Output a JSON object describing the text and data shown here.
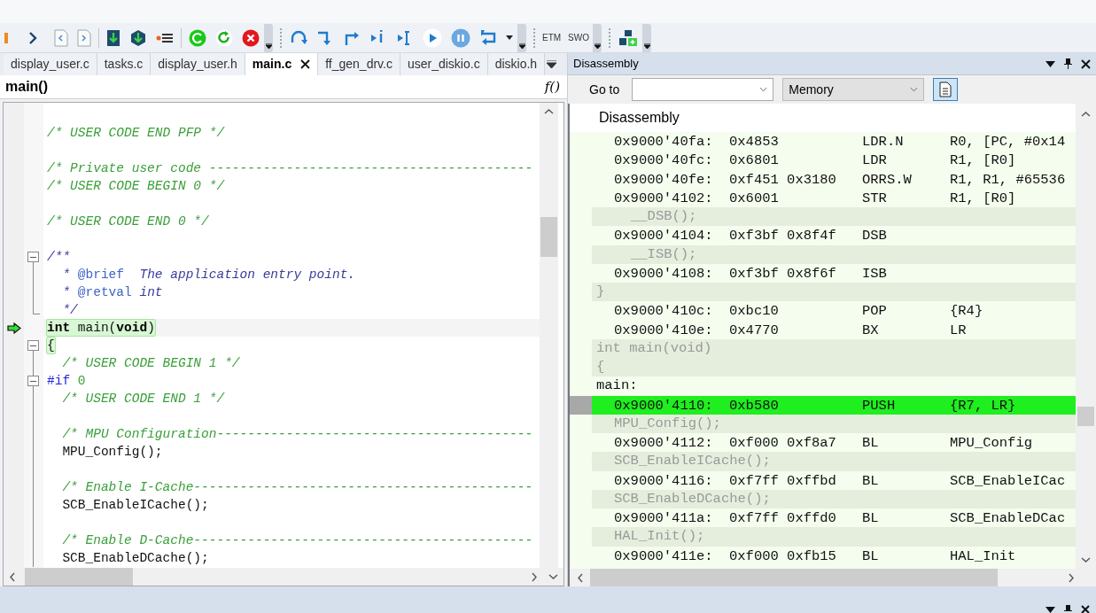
{
  "toolbar": {
    "trace_labels": [
      "ETM",
      "SWO"
    ]
  },
  "tabs": [
    {
      "label": "display_user.c",
      "selected": false
    },
    {
      "label": "tasks.c",
      "selected": false
    },
    {
      "label": "display_user.h",
      "selected": false
    },
    {
      "label": "main.c",
      "selected": true
    },
    {
      "label": "ff_gen_drv.c",
      "selected": false
    },
    {
      "label": "user_diskio.c",
      "selected": false
    },
    {
      "label": "diskio.h",
      "selected": false
    }
  ],
  "function_bar": {
    "name": "main()",
    "button": "f()"
  },
  "editor": {
    "lines": [
      {
        "kind": "blank"
      },
      {
        "kind": "code",
        "segments": [
          {
            "t": "/* USER CODE END PFP */",
            "kind": "comment"
          }
        ]
      },
      {
        "kind": "blank"
      },
      {
        "kind": "code",
        "segments": [
          {
            "t": "/* Private user code ------------------------------------------",
            "kind": "comment"
          }
        ]
      },
      {
        "kind": "code",
        "segments": [
          {
            "t": "/* USER CODE BEGIN 0 */",
            "kind": "comment"
          }
        ]
      },
      {
        "kind": "blank"
      },
      {
        "kind": "code",
        "segments": [
          {
            "t": "/* USER CODE END 0 */",
            "kind": "comment"
          }
        ]
      },
      {
        "kind": "blank"
      },
      {
        "kind": "fold_start",
        "expanded": true,
        "segments": [
          {
            "t": "/**",
            "kind": "doc"
          }
        ]
      },
      {
        "kind": "fold_body",
        "segments": [
          {
            "t": "  * ",
            "kind": "doc"
          },
          {
            "t": "@brief",
            "kind": "doctag"
          },
          {
            "t": "  The application entry point.",
            "kind": "doc"
          }
        ]
      },
      {
        "kind": "fold_body",
        "segments": [
          {
            "t": "  * ",
            "kind": "doc"
          },
          {
            "t": "@retval",
            "kind": "doctag"
          },
          {
            "t": " int",
            "kind": "doc"
          }
        ]
      },
      {
        "kind": "fold_end",
        "segments": [
          {
            "t": "  */",
            "kind": "doc"
          }
        ]
      },
      {
        "kind": "code",
        "current": true,
        "segments": [
          {
            "t": "int",
            "kind": "keyword"
          },
          {
            "t": " main(",
            "kind": "plain"
          },
          {
            "t": "void",
            "kind": "keyword"
          },
          {
            "t": ")",
            "kind": "plain"
          }
        ]
      },
      {
        "kind": "fold_start",
        "expanded": true,
        "brace_match": true,
        "segments": [
          {
            "t": "{",
            "kind": "plain"
          }
        ]
      },
      {
        "kind": "fold_body",
        "segments": [
          {
            "t": "  /* USER CODE BEGIN 1 */",
            "kind": "comment"
          }
        ]
      },
      {
        "kind": "fold_start",
        "expanded": true,
        "segments": [
          {
            "t": "#if",
            "kind": "preproc"
          },
          {
            "t": " 0",
            "kind": "number"
          }
        ]
      },
      {
        "kind": "fold_body",
        "segments": [
          {
            "t": "  /* USER CODE END 1 */",
            "kind": "comment"
          }
        ]
      },
      {
        "kind": "fold_blank"
      },
      {
        "kind": "fold_body",
        "segments": [
          {
            "t": "  /* MPU Configuration-----------------------------------------",
            "kind": "comment"
          }
        ]
      },
      {
        "kind": "fold_body",
        "segments": [
          {
            "t": "  MPU_Config();",
            "kind": "plain"
          }
        ]
      },
      {
        "kind": "fold_blank"
      },
      {
        "kind": "fold_body",
        "segments": [
          {
            "t": "  /* Enable I-Cache--------------------------------------------",
            "kind": "comment"
          }
        ]
      },
      {
        "kind": "fold_body",
        "segments": [
          {
            "t": "  SCB_EnableICache();",
            "kind": "plain"
          }
        ]
      },
      {
        "kind": "fold_blank"
      },
      {
        "kind": "fold_body",
        "segments": [
          {
            "t": "  /* Enable D-Cache--------------------------------------------",
            "kind": "comment"
          }
        ]
      },
      {
        "kind": "fold_body",
        "segments": [
          {
            "t": "  SCB_EnableDCache();",
            "kind": "plain"
          }
        ]
      }
    ]
  },
  "disassembly": {
    "title": "Disassembly",
    "goto_label": "Go to",
    "memory_select": "Memory",
    "header": "Disassembly",
    "rows": [
      {
        "kind": "instr",
        "address": "0x9000'40fa:",
        "opcode": "0x4853",
        "mnemonic": "LDR.N",
        "operands": "R0, [PC, #0x14"
      },
      {
        "kind": "instr",
        "address": "0x9000'40fc:",
        "opcode": "0x6801",
        "mnemonic": "LDR",
        "operands": "R1, [R0]"
      },
      {
        "kind": "instr",
        "address": "0x9000'40fe:",
        "opcode": "0xf451 0x3180",
        "mnemonic": "ORRS.W",
        "operands": "R1, R1, #65536"
      },
      {
        "kind": "instr",
        "address": "0x9000'4102:",
        "opcode": "0x6001",
        "mnemonic": "STR",
        "operands": "R1, [R0]"
      },
      {
        "kind": "source_inline",
        "text": "__DSB();"
      },
      {
        "kind": "instr",
        "address": "0x9000'4104:",
        "opcode": "0xf3bf 0x8f4f",
        "mnemonic": "DSB"
      },
      {
        "kind": "source_inline",
        "text": "__ISB();"
      },
      {
        "kind": "instr",
        "address": "0x9000'4108:",
        "opcode": "0xf3bf 0x8f6f",
        "mnemonic": "ISB"
      },
      {
        "kind": "source_top",
        "text": "}"
      },
      {
        "kind": "instr",
        "address": "0x9000'410c:",
        "opcode": "0xbc10",
        "mnemonic": "POP",
        "operands": "{R4}"
      },
      {
        "kind": "instr",
        "address": "0x9000'410e:",
        "opcode": "0x4770",
        "mnemonic": "BX",
        "operands": "LR"
      },
      {
        "kind": "source_top",
        "text": "int main(void)"
      },
      {
        "kind": "source_top",
        "text": "{"
      },
      {
        "kind": "label",
        "text": "main:"
      },
      {
        "kind": "instr",
        "current": true,
        "address": "0x9000'4110:",
        "opcode": "0xb580",
        "mnemonic": "PUSH",
        "operands": "{R7, LR}"
      },
      {
        "kind": "source",
        "text": "MPU_Config();"
      },
      {
        "kind": "instr",
        "address": "0x9000'4112:",
        "opcode": "0xf000 0xf8a7",
        "mnemonic": "BL",
        "operands": "MPU_Config"
      },
      {
        "kind": "source",
        "text": "SCB_EnableICache();"
      },
      {
        "kind": "instr",
        "address": "0x9000'4116:",
        "opcode": "0xf7ff 0xffbd",
        "mnemonic": "BL",
        "operands": "SCB_EnableICac"
      },
      {
        "kind": "source",
        "text": "SCB_EnableDCache();"
      },
      {
        "kind": "instr",
        "address": "0x9000'411a:",
        "opcode": "0xf7ff 0xffd0",
        "mnemonic": "BL",
        "operands": "SCB_EnableDCac"
      },
      {
        "kind": "source",
        "text": "HAL_Init();"
      },
      {
        "kind": "instr",
        "address": "0x9000'411e:",
        "opcode": "0xf000 0xfb15",
        "mnemonic": "BL",
        "operands": "HAL_Init"
      }
    ]
  }
}
